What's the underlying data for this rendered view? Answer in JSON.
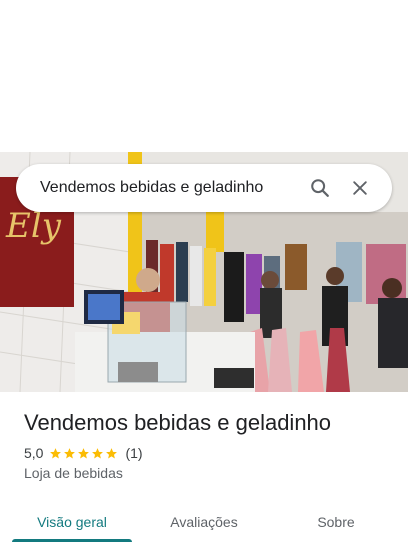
{
  "search": {
    "query": "Vendemos bebidas e geladinho",
    "search_icon": "search-icon",
    "close_icon": "close-icon"
  },
  "photo": {
    "wall_sign_text": "Ely"
  },
  "place": {
    "name": "Vendemos bebidas e geladinho",
    "rating": "5,0",
    "review_count": "(1)",
    "category": "Loja de bebidas",
    "star_color": "#fbbc04"
  },
  "tabs": [
    {
      "label": "Visão geral",
      "active": true
    },
    {
      "label": "Avaliações",
      "active": false
    },
    {
      "label": "Sobre",
      "active": false
    }
  ],
  "colors": {
    "accent": "#137a7f"
  }
}
